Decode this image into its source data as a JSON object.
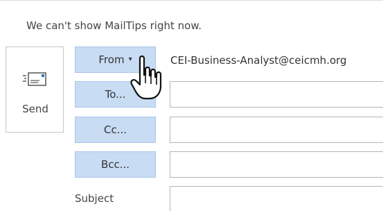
{
  "mailtips": {
    "message": "We can't show MailTips right now."
  },
  "send": {
    "label": "Send",
    "icon": "envelope-send-icon"
  },
  "fields": {
    "from": {
      "label": "From",
      "caret": "▾",
      "value": "CEI-Business-Analyst@ceicmh.org"
    },
    "to": {
      "label": "To...",
      "value": ""
    },
    "cc": {
      "label": "Cc...",
      "value": ""
    },
    "bcc": {
      "label": "Bcc...",
      "value": ""
    },
    "subject": {
      "label": "Subject",
      "value": ""
    }
  },
  "cursor": {
    "icon": "hand-pointer-icon"
  },
  "colors": {
    "button_fill": "#c8dcf3",
    "button_border": "#a9c6e8",
    "input_border": "#b4b4b4",
    "envelope_accent": "#2e75c6"
  }
}
